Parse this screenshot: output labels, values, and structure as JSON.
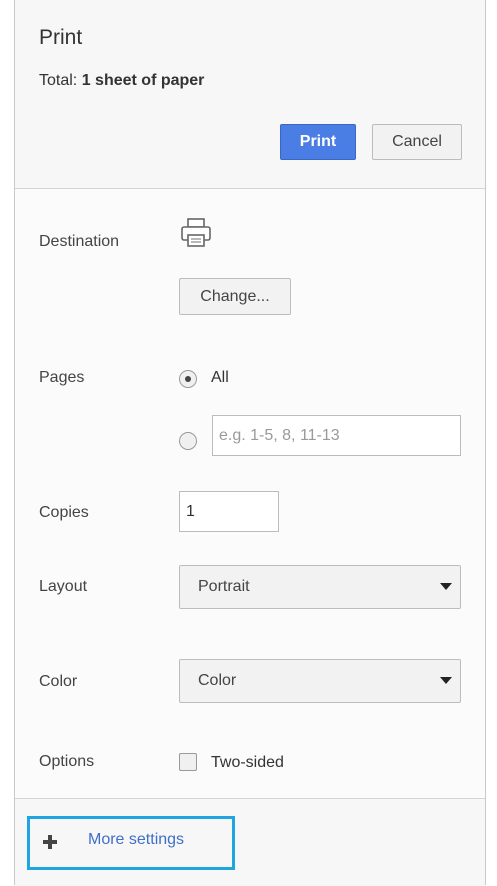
{
  "header": {
    "title": "Print",
    "total_prefix": "Total:",
    "total_value": "1 sheet of paper",
    "print_label": "Print",
    "cancel_label": "Cancel"
  },
  "destination": {
    "label": "Destination",
    "icon": "printer-icon",
    "change_label": "Change..."
  },
  "pages": {
    "label": "Pages",
    "all_label": "All",
    "all_selected": true,
    "custom_placeholder": "e.g. 1-5, 8, 11-13",
    "custom_value": ""
  },
  "copies": {
    "label": "Copies",
    "value": "1"
  },
  "layout": {
    "label": "Layout",
    "selected": "Portrait"
  },
  "color": {
    "label": "Color",
    "selected": "Color"
  },
  "options": {
    "label": "Options",
    "two_sided_label": "Two-sided",
    "two_sided_checked": false
  },
  "footer": {
    "more_settings_label": "More settings",
    "icon": "plus-icon",
    "highlight_color": "#1fa6e0"
  },
  "colors": {
    "print_button": "#4a7ee4",
    "link": "#3f6fc9"
  }
}
